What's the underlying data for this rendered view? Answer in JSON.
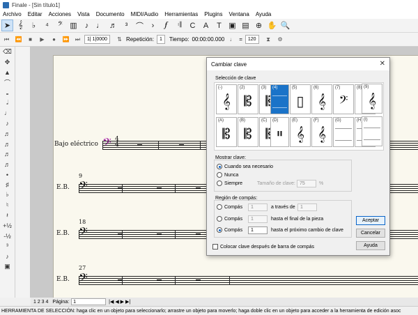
{
  "window": {
    "title": "Finale - [Sin título1]"
  },
  "menu": [
    "Archivo",
    "Editar",
    "Acciones",
    "Vista",
    "Documento",
    "MIDI/Audio",
    "Herramientas",
    "Plugins",
    "Ventana",
    "Ayuda"
  ],
  "playback": {
    "measure_value": "1| 1|0000",
    "repeat_label": "Repetición:",
    "repeat_value": "1",
    "time_label": "Tiempo:",
    "time_value": "00:00:00.000",
    "tempo_value": "120"
  },
  "score": {
    "instrument_full": "Bajo eléctrico",
    "instrument_short": "E.B.",
    "measure_numbers": [
      "9",
      "18",
      "27"
    ]
  },
  "dialog": {
    "title": "Cambiar clave",
    "close": "✕",
    "clef_selection_label": "Selección de clave",
    "clefs": [
      {
        "num": "(-)",
        "sym": "𝄞"
      },
      {
        "num": "(2)",
        "sym": "𝄡"
      },
      {
        "num": "(3)",
        "sym": "𝄡"
      },
      {
        "num": "(4)",
        "sym": "𝄡"
      },
      {
        "num": "(5)",
        "sym": "▯"
      },
      {
        "num": "(6)",
        "sym": "𝄞"
      },
      {
        "num": "(7)",
        "sym": "𝄢"
      },
      {
        "num": "(8)",
        "sym": "𝄢"
      },
      {
        "num": "(9)",
        "sym": "𝄞"
      },
      {
        "num": "(A)",
        "sym": "𝄡"
      },
      {
        "num": "(B)",
        "sym": "𝄡"
      },
      {
        "num": "(C)",
        "sym": "𝄡"
      },
      {
        "num": "(D)",
        "sym": "𝄥"
      },
      {
        "num": "(E)",
        "sym": "𝄞"
      },
      {
        "num": "(F)",
        "sym": "𝄞"
      },
      {
        "num": "(G)",
        "sym": ""
      },
      {
        "num": "(H)",
        "sym": ""
      },
      {
        "num": "(I)",
        "sym": ""
      }
    ],
    "show_clef_label": "Mostrar clave:",
    "show_always_needed": "Cuando sea necesario",
    "show_never": "Nunca",
    "show_always": "Siempre",
    "size_label": "Tamaño de clave:",
    "size_value": "75",
    "size_unit": "%",
    "region_label": "Región de compás:",
    "r1_label": "Compás",
    "r1_from": "1",
    "r1_mid": "a través de",
    "r1_to": "1",
    "r2_label": "Compás",
    "r2_from": "1",
    "r2_text": "hasta el final de la pieza",
    "r3_label": "Compás",
    "r3_from": "1",
    "r3_text": "hasta el próximo cambio de clave",
    "place_after_barline": "Colocar clave después de barra de compás",
    "ok": "Aceptar",
    "cancel": "Cancelar",
    "help": "Ayuda"
  },
  "pagebar": {
    "pages": "1  2  3  4",
    "label": "Página:",
    "value": "1"
  },
  "status": "HERRAMIENTA DE SELECCIÓN: haga clic en un objeto para seleccionarlo; arrastre un objeto para moverlo; haga doble clic en un objeto para acceder a la herramienta de edición asoc",
  "colors": {
    "selected_clef": "#1a73c8",
    "clef_magenta": "#a020a0"
  }
}
